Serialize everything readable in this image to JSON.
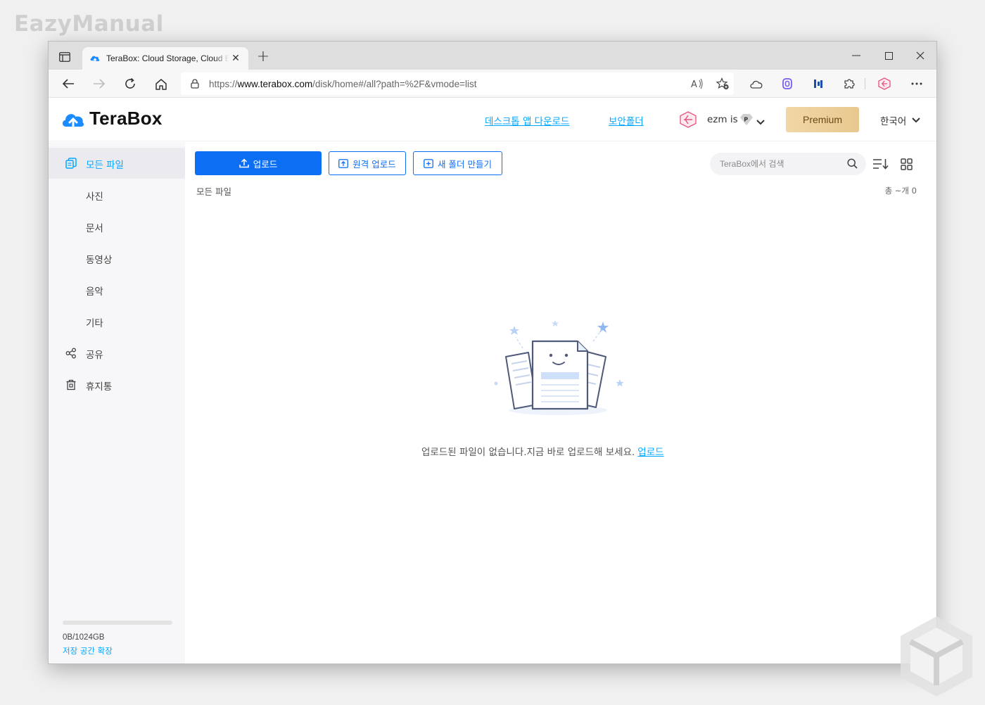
{
  "watermark": "EazyManual",
  "browser": {
    "tab_title": "TeraBox: Cloud Storage, Cloud Backup",
    "url_prefix": "https://",
    "url_host": "www.terabox.com",
    "url_path": "/disk/home#/all?path=%2F&vmode=list"
  },
  "header": {
    "brand": "TeraBox",
    "desktop_app_link": "데스크톱 앱 다운로드",
    "secure_folder_link": "보안폴더",
    "user_name": "ezm is",
    "premium_label": "Premium",
    "language": "한국어"
  },
  "sidebar": {
    "items": [
      {
        "label": "모든 파일"
      },
      {
        "label": "사진"
      },
      {
        "label": "문서"
      },
      {
        "label": "동영상"
      },
      {
        "label": "음악"
      },
      {
        "label": "기타"
      },
      {
        "label": "공유"
      },
      {
        "label": "휴지통"
      }
    ],
    "storage_used": "0B/1024GB",
    "storage_fraction": 0,
    "storage_expand": "저장 공간 확장"
  },
  "main": {
    "upload_label": "업로드",
    "remote_upload_label": "원격 업로드",
    "new_folder_label": "새 폴더 만들기",
    "search_placeholder": "TeraBox에서 검색",
    "breadcrumb": "모든 파일",
    "count": "총 ~개 0",
    "empty_message": "업로드된 파일이 없습니다.지금 바로 업로드해 보세요.",
    "empty_upload_link": "업로드"
  },
  "colors": {
    "accent": "#06a7ff",
    "primary_button": "#0c6ef2",
    "premium": "#e8c88f"
  }
}
